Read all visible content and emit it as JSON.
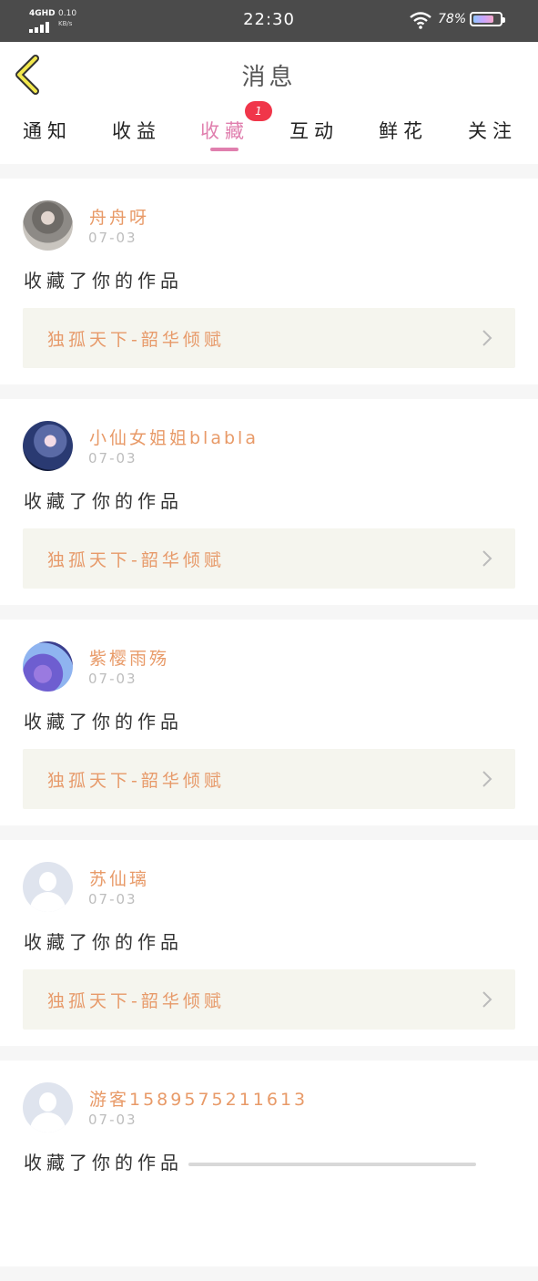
{
  "status_bar": {
    "network": "4GHD",
    "speed": "0.10",
    "speed_unit": "KB/s",
    "time": "22:30",
    "battery": "78%"
  },
  "header": {
    "title": "消息",
    "back_icon": "chevron-left-icon"
  },
  "tabs": [
    {
      "label": "通知"
    },
    {
      "label": "收益"
    },
    {
      "label": "收藏",
      "active": true
    },
    {
      "label": "互动"
    },
    {
      "label": "鲜花"
    },
    {
      "label": "关注"
    }
  ],
  "badge": "1",
  "messages": [
    {
      "name": "舟舟呀",
      "date": "07-03",
      "action": "收藏了你的作品",
      "work": "独孤天下-韶华倾赋"
    },
    {
      "name": "小仙女姐姐blabla",
      "date": "07-03",
      "action": "收藏了你的作品",
      "work": "独孤天下-韶华倾赋"
    },
    {
      "name": "紫樱雨殇",
      "date": "07-03",
      "action": "收藏了你的作品",
      "work": "独孤天下-韶华倾赋"
    },
    {
      "name": "苏仙璃",
      "date": "07-03",
      "action": "收藏了你的作品",
      "work": "独孤天下-韶华倾赋"
    },
    {
      "name": "游客1589575211613",
      "date": "07-03",
      "action": "收藏了你的作品",
      "work": ""
    }
  ],
  "colors": {
    "accent": "#e07fae",
    "name_text": "#e89a68",
    "badge": "#f0364a"
  }
}
